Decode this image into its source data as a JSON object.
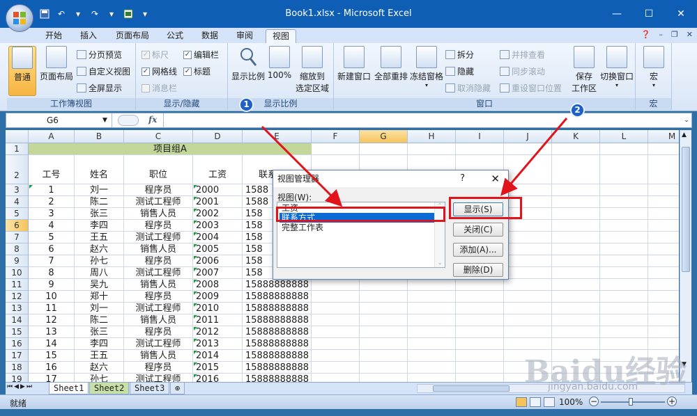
{
  "window": {
    "title": "Book1.xlsx - Microsoft Excel"
  },
  "ribbon_tabs": [
    "开始",
    "插入",
    "页面布局",
    "公式",
    "数据",
    "审阅",
    "视图"
  ],
  "active_tab": "视图",
  "ribbon": {
    "workbook_views": {
      "label": "工作簿视图",
      "normal": "普通",
      "page_layout": "页面布局",
      "page_break": "分页预览",
      "custom_views": "自定义视图",
      "full_screen": "全屏显示"
    },
    "show_hide": {
      "label": "显示/隐藏",
      "ruler": "标尺",
      "gridlines": "网格线",
      "message_bar": "消息栏",
      "formula_bar": "编辑栏",
      "headings": "标题"
    },
    "zoom": {
      "label": "显示比例",
      "zoom": "显示比例",
      "hundred": "100%",
      "zoom_sel_line1": "缩放到",
      "zoom_sel_line2": "选定区域"
    },
    "window": {
      "label": "窗口",
      "new_window": "新建窗口",
      "arrange_all": "全部重排",
      "freeze_panes": "冻结窗格",
      "split": "拆分",
      "hide": "隐藏",
      "unhide": "取消隐藏",
      "side_by_side": "并排查看",
      "sync_scroll": "同步滚动",
      "reset_position": "重设窗口位置",
      "save_workspace_line1": "保存",
      "save_workspace_line2": "工作区",
      "switch_windows": "切换窗口"
    },
    "macros": {
      "label": "宏",
      "macro": "宏"
    }
  },
  "formula_bar": {
    "name_box": "G6",
    "fx": "fx",
    "content": ""
  },
  "columns": [
    "A",
    "B",
    "C",
    "D",
    "E",
    "F",
    "G",
    "H",
    "I",
    "J",
    "K",
    "L",
    "M"
  ],
  "selected_column": "G",
  "selected_row": "6",
  "sheet": {
    "merged_title": "项目组A",
    "headers": [
      "工号",
      "姓名",
      "职位",
      "工资",
      "联系方式"
    ],
    "rows": [
      [
        "1",
        "刘一",
        "程序员",
        "2000",
        "1588"
      ],
      [
        "2",
        "陈二",
        "测试工程师",
        "2001",
        "1588"
      ],
      [
        "3",
        "张三",
        "销售人员",
        "2002",
        "158"
      ],
      [
        "4",
        "李四",
        "程序员",
        "2003",
        "158"
      ],
      [
        "5",
        "王五",
        "测试工程师",
        "2004",
        "158"
      ],
      [
        "6",
        "赵六",
        "销售人员",
        "2005",
        "158"
      ],
      [
        "7",
        "孙七",
        "程序员",
        "2006",
        "158"
      ],
      [
        "8",
        "周八",
        "测试工程师",
        "2007",
        "158"
      ],
      [
        "9",
        "吴九",
        "销售人员",
        "2008",
        "15888888888"
      ],
      [
        "10",
        "郑十",
        "程序员",
        "2009",
        "15888888888"
      ],
      [
        "11",
        "刘一",
        "测试工程师",
        "2010",
        "15888888888"
      ],
      [
        "12",
        "陈二",
        "销售人员",
        "2011",
        "15888888888"
      ],
      [
        "13",
        "张三",
        "程序员",
        "2012",
        "15888888888"
      ],
      [
        "14",
        "李四",
        "测试工程师",
        "2013",
        "15888888888"
      ],
      [
        "15",
        "王五",
        "销售人员",
        "2014",
        "15888888888"
      ],
      [
        "16",
        "赵六",
        "程序员",
        "2015",
        "15888888888"
      ],
      [
        "17",
        "孙七",
        "测试工程师",
        "2016",
        "15888888888"
      ]
    ],
    "row_numbers": [
      "1",
      "2",
      "3",
      "4",
      "5",
      "6",
      "7",
      "8",
      "9",
      "10",
      "11",
      "12",
      "13",
      "14",
      "15",
      "16",
      "17",
      "18",
      "19"
    ]
  },
  "sheet_tabs": [
    "Sheet1",
    "Sheet2",
    "Sheet3"
  ],
  "status": {
    "ready": "就绪",
    "zoom": "100%"
  },
  "dialog": {
    "title": "视图管理器",
    "help": "?",
    "close": "✕",
    "list_label": "视图(W):",
    "views": [
      "工资",
      "联系方式",
      "完整工作表"
    ],
    "selected_view": "联系方式",
    "buttons": {
      "show": "显示(S)",
      "close": "关闭(C)",
      "add": "添加(A)...",
      "delete": "删除(D)"
    }
  },
  "annotations": {
    "badge1": "1",
    "badge2": "2"
  },
  "watermark": {
    "brand": "Baidu经验",
    "url": "jingyan.baidu.com"
  },
  "colors": {
    "titlebar": "#0f5eb6",
    "header_fill": "#c4d79b",
    "highlight": "#e0141a",
    "selection": "#0b6bd4"
  }
}
